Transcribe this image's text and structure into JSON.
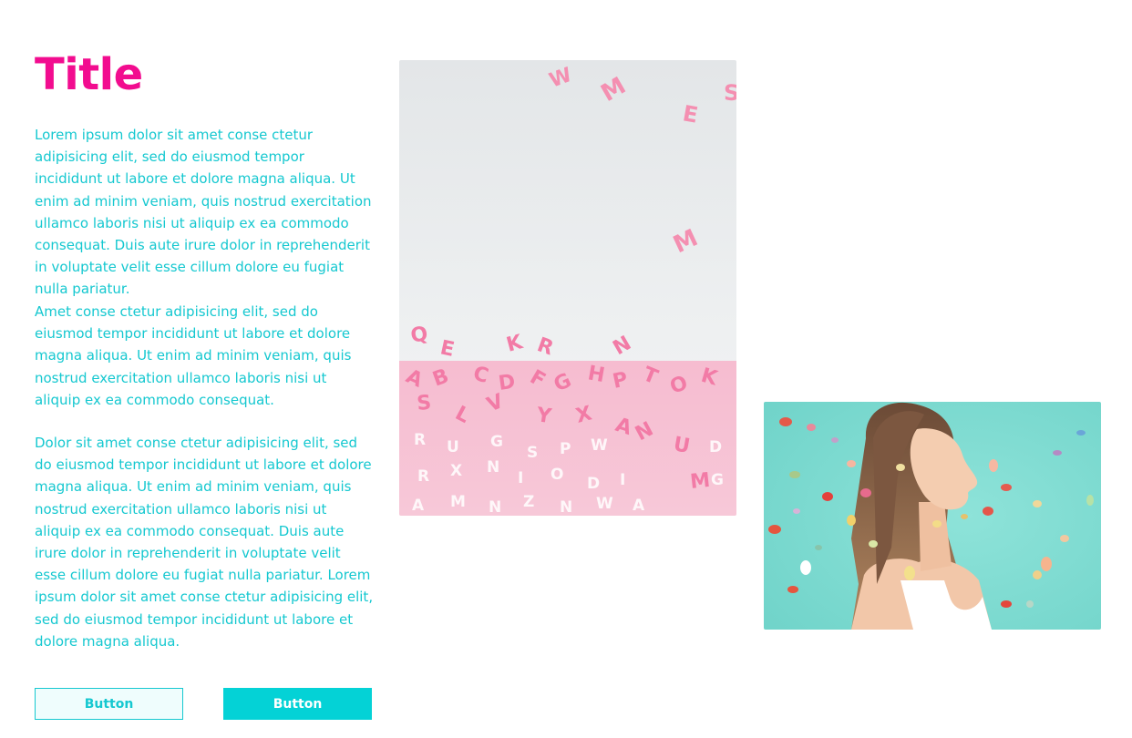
{
  "header": {
    "title": "Title"
  },
  "content": {
    "paragraphs": [
      "Lorem ipsum dolor sit amet conse ctetur adipisicing elit, sed do eiusmod tempor incididunt ut labore et dolore magna aliqua. Ut enim ad minim veniam, quis nostrud exercitation ullamco laboris nisi ut aliquip ex ea commodo consequat. Duis aute irure dolor in reprehenderit in voluptate velit esse cillum dolore eu fugiat nulla pariatur.",
      "Amet conse ctetur adipisicing elit, sed do eiusmod tempor incididunt ut labore et dolore magna aliqua. Ut enim ad minim veniam, quis nostrud exercitation ullamco laboris nisi ut aliquip ex ea commodo consequat.",
      "Dolor sit amet conse ctetur adipisicing elit, sed do eiusmod tempor incididunt ut labore et dolore magna aliqua. Ut enim ad minim veniam, quis nostrud exercitation ullamco laboris nisi ut aliquip ex ea commodo consequat. Duis aute irure dolor in reprehenderit in voluptate velit esse cillum dolore eu fugiat nulla pariatur. Lorem ipsum dolor sit amet conse ctetur adipisicing elit, sed do eiusmod tempor incididunt ut labore et dolore magna aliqua."
    ]
  },
  "actions": {
    "secondary_label": "Button",
    "primary_label": "Button"
  },
  "images": [
    {
      "name": "pink-letters-photo"
    },
    {
      "name": "confetti-portrait-photo"
    }
  ],
  "colors": {
    "title": "#f20c8f",
    "text": "#15c8d0",
    "primary_button": "#04d2d6",
    "secondary_button_bg": "#effdfd"
  }
}
